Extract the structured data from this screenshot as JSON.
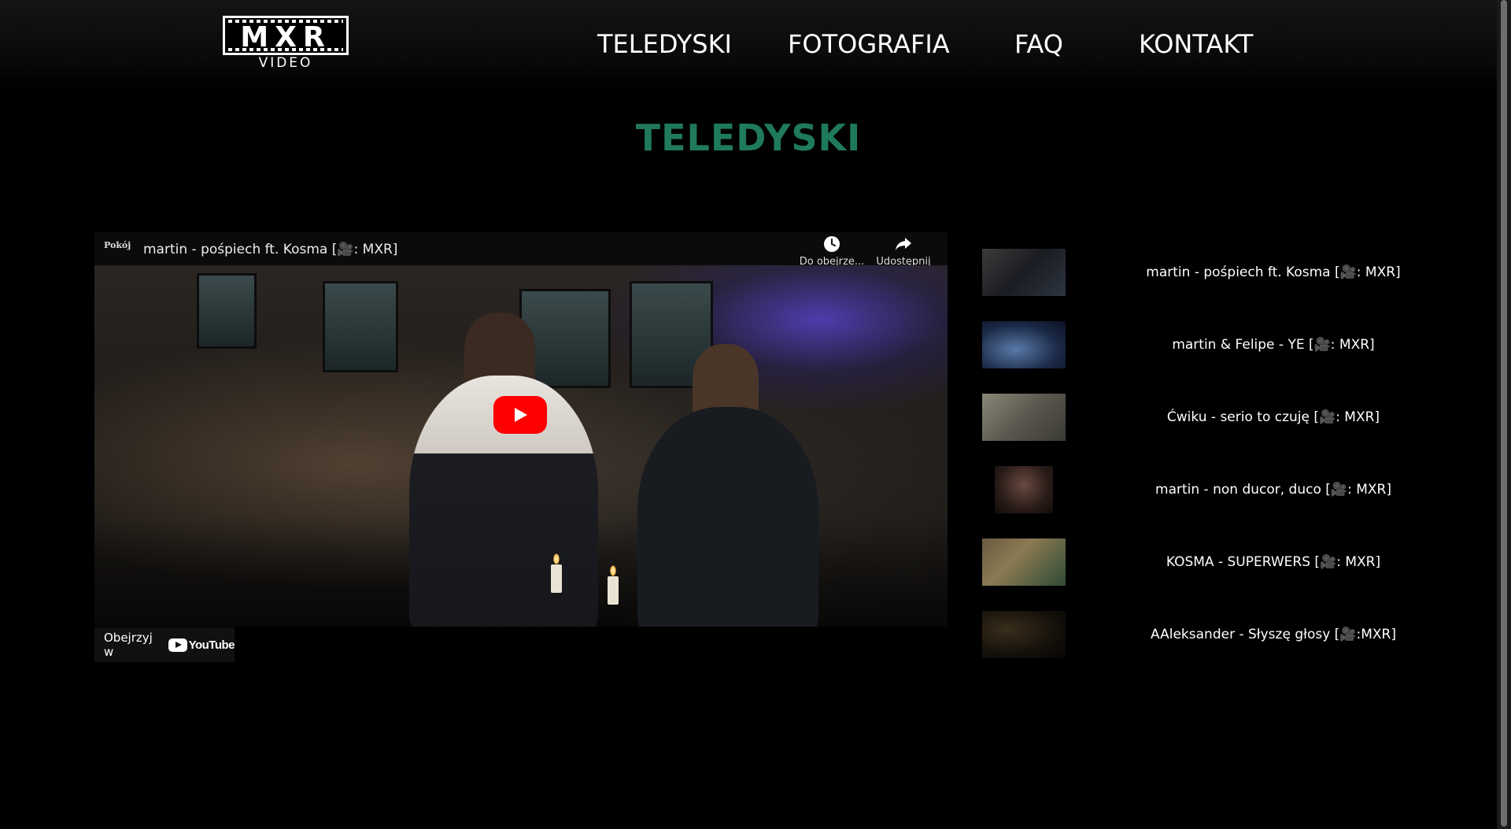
{
  "logo": {
    "letters": "MXR",
    "sub": "VIDEO"
  },
  "nav": {
    "items": [
      "TELEDYSKI",
      "FOTOGRAFIA",
      "FAQ",
      "KONTAKT"
    ]
  },
  "page_title": "TELEDYSKI",
  "player": {
    "channel_avatar_text": "Pokój",
    "title": "martin - pośpiech ft. Kosma [🎥: MXR]",
    "watch_later_label": "Do obejrze...",
    "share_label": "Udostępnij",
    "watch_on_label": "Obejrzyj w",
    "youtube_word": "YouTube"
  },
  "playlist": [
    {
      "title": "martin - pośpiech ft. Kosma [🎥: MXR]",
      "thumb": "thumb-1"
    },
    {
      "title": "martin & Felipe - YE [🎥: MXR]",
      "thumb": "thumb-2"
    },
    {
      "title": "Ćwiku - serio to czuję [🎥: MXR]",
      "thumb": "thumb-3"
    },
    {
      "title": "martin - non ducor, duco [🎥: MXR]",
      "thumb": "thumb-4"
    },
    {
      "title": "KOSMA - SUPERWERS [🎥: MXR]",
      "thumb": "thumb-5"
    },
    {
      "title": "AAleksander - Słyszę głosy [🎥:MXR]",
      "thumb": "thumb-6"
    }
  ],
  "colors": {
    "accent": "#1f7a5c",
    "youtube_red": "#ff0000"
  }
}
